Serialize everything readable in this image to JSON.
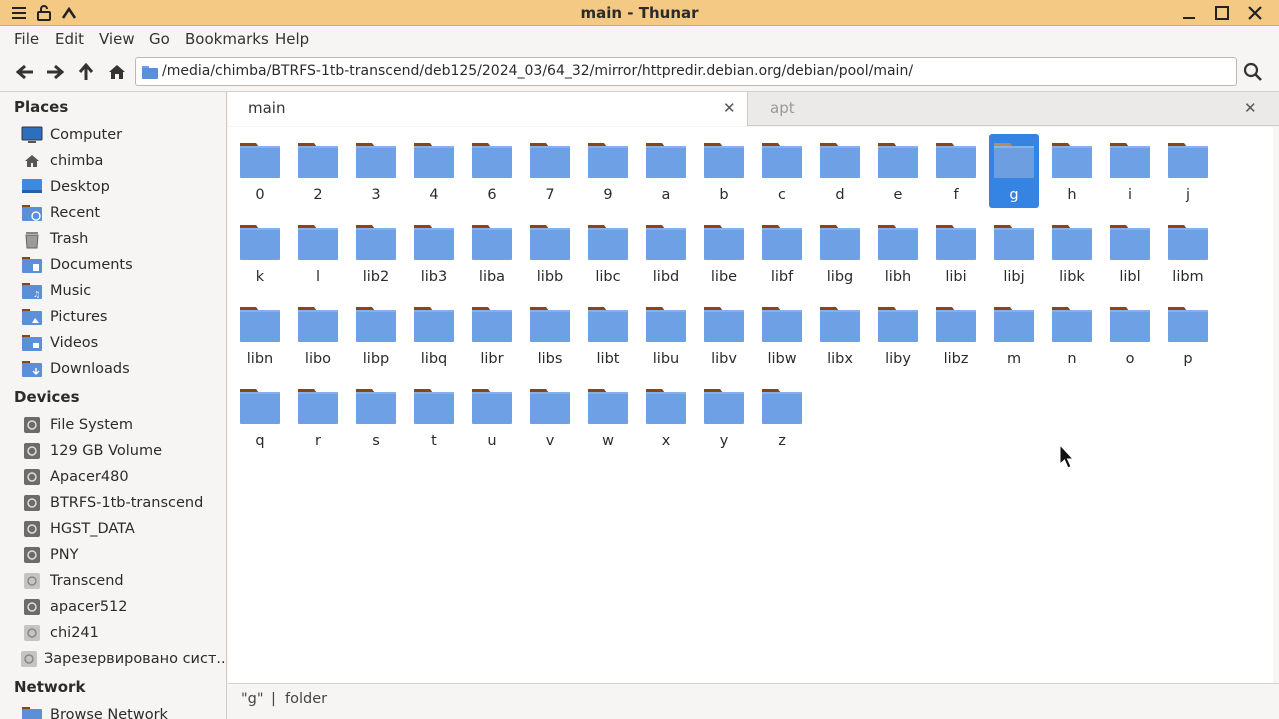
{
  "window": {
    "title": "main - Thunar"
  },
  "menu": [
    "File",
    "Edit",
    "View",
    "Go",
    "Bookmarks",
    "Help"
  ],
  "location": {
    "path": "/media/chimba/BTRFS-1tb-transcend/deb125/2024_03/64_32/mirror/httpredir.debian.org/debian/pool/main/"
  },
  "sidebar": {
    "places_header": "Places",
    "places": [
      {
        "label": "Computer",
        "icon": "computer-icon"
      },
      {
        "label": "chimba",
        "icon": "home-icon"
      },
      {
        "label": "Desktop",
        "icon": "desktop-icon"
      },
      {
        "label": "Recent",
        "icon": "recent-icon"
      },
      {
        "label": "Trash",
        "icon": "trash-icon"
      },
      {
        "label": "Documents",
        "icon": "documents-folder-icon"
      },
      {
        "label": "Music",
        "icon": "music-folder-icon"
      },
      {
        "label": "Pictures",
        "icon": "pictures-folder-icon"
      },
      {
        "label": "Videos",
        "icon": "videos-folder-icon"
      },
      {
        "label": "Downloads",
        "icon": "downloads-folder-icon"
      }
    ],
    "devices_header": "Devices",
    "devices": [
      {
        "label": "File System",
        "icon": "drive-icon"
      },
      {
        "label": "129 GB Volume",
        "icon": "drive-icon"
      },
      {
        "label": "Apacer480",
        "icon": "drive-icon"
      },
      {
        "label": "BTRFS-1tb-transcend",
        "icon": "drive-icon"
      },
      {
        "label": "HGST_DATA",
        "icon": "drive-icon"
      },
      {
        "label": "PNY",
        "icon": "drive-icon"
      },
      {
        "label": "Transcend",
        "icon": "drive-unmounted-icon"
      },
      {
        "label": "apacer512",
        "icon": "drive-icon"
      },
      {
        "label": "chi241",
        "icon": "drive-unmounted-icon"
      },
      {
        "label": "Зарезервировано сист...",
        "icon": "drive-unmounted-icon"
      }
    ],
    "network_header": "Network",
    "network": [
      {
        "label": "Browse Network",
        "icon": "network-icon"
      }
    ]
  },
  "tabs": [
    {
      "label": "main",
      "active": true
    },
    {
      "label": "apt",
      "active": false
    }
  ],
  "folders": [
    "0",
    "2",
    "3",
    "4",
    "6",
    "7",
    "9",
    "a",
    "b",
    "c",
    "d",
    "e",
    "f",
    "g",
    "h",
    "i",
    "j",
    "k",
    "l",
    "lib2",
    "lib3",
    "liba",
    "libb",
    "libc",
    "libd",
    "libe",
    "libf",
    "libg",
    "libh",
    "libi",
    "libj",
    "libk",
    "libl",
    "libm",
    "libn",
    "libo",
    "libp",
    "libq",
    "libr",
    "libs",
    "libt",
    "libu",
    "libv",
    "libw",
    "libx",
    "liby",
    "libz",
    "m",
    "n",
    "o",
    "p",
    "q",
    "r",
    "s",
    "t",
    "u",
    "v",
    "w",
    "x",
    "y",
    "z"
  ],
  "selected_folder": "g",
  "status": {
    "name": "\"g\"",
    "sep": "|",
    "type": "folder"
  },
  "colors": {
    "titlebar": "#f4c983",
    "folder_blue": "#6ea0e6",
    "folder_tab": "#8b4513",
    "selection": "#3584e4"
  }
}
